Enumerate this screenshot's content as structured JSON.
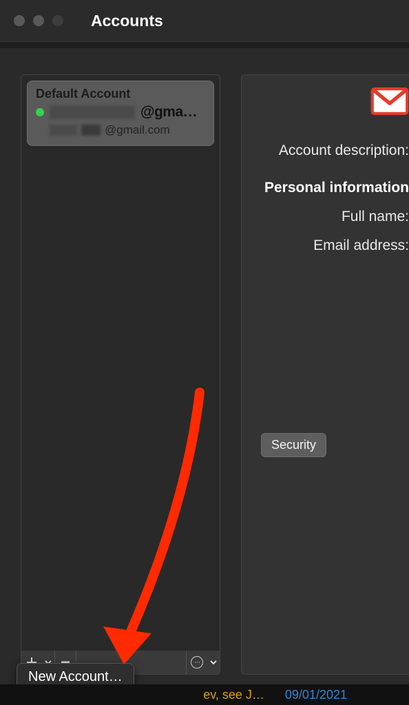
{
  "window": {
    "title": "Accounts"
  },
  "sidebar": {
    "account": {
      "header": "Default Account",
      "primary_suffix": "@gma…",
      "secondary_suffix": "@gmail.com"
    },
    "toolbar": {
      "add_icon": "plus-icon",
      "add_menu_icon": "chevron-down-icon",
      "remove_icon": "minus-icon",
      "actions_icon": "ellipsis-circle-icon",
      "actions_menu_icon": "chevron-down-icon"
    }
  },
  "detail": {
    "provider": "Gmail",
    "provider_icon": "gmail-icon",
    "desc_label": "Account description:",
    "section_label": "Personal information",
    "fullname_label": "Full name:",
    "email_label": "Email address:",
    "security_button": "Security"
  },
  "popup": {
    "new_account": "New Account…"
  },
  "footer": {
    "subject_fragment": "ev, see J…",
    "date": "09/01/2021"
  },
  "annotation": {
    "arrow_color": "#ff2a00"
  }
}
